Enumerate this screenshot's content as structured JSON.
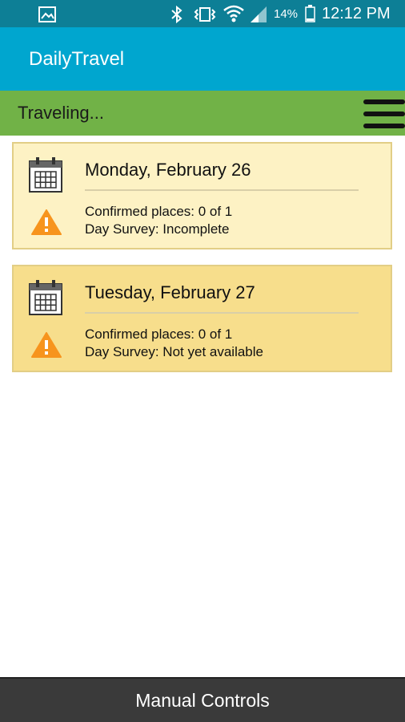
{
  "status_bar": {
    "battery_percent": "14%",
    "time": "12:12 PM"
  },
  "app_bar": {
    "title": "DailyTravel"
  },
  "traveling_bar": {
    "status_text": "Traveling...",
    "menu_icon": "hamburger-menu-icon"
  },
  "days": [
    {
      "date": "Monday, February 26",
      "confirmed": "Confirmed places: 0 of 1",
      "survey": "Day Survey: Incomplete",
      "background": "#fdf2c4"
    },
    {
      "date": "Tuesday, February 27",
      "confirmed": "Confirmed places: 0 of 1",
      "survey": "Day Survey: Not yet available",
      "background": "#f7de8c"
    }
  ],
  "footer": {
    "label": "Manual Controls"
  },
  "colors": {
    "status_bar": "#0d7f96",
    "app_bar": "#00a6cf",
    "traveling_bar": "#71b247",
    "warning": "#f7941d",
    "footer": "#3a3a3a"
  }
}
